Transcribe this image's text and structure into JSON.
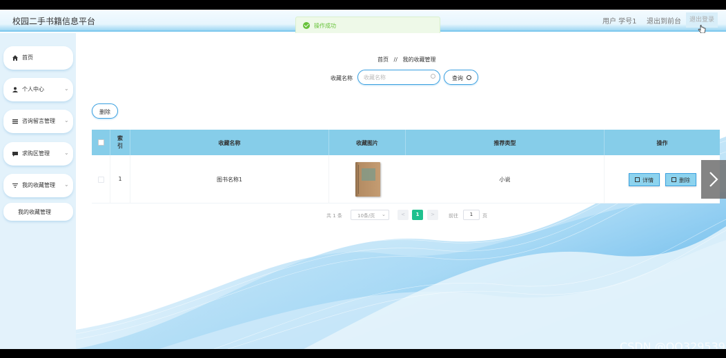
{
  "header": {
    "app_title": "校园二手书籍信息平台",
    "user_label": "用户 学号1",
    "front_label": "退出到前台",
    "logout_label": "退出登录"
  },
  "toast": {
    "message": "操作成功",
    "icon": "check-circle-icon",
    "color": "#67c23a"
  },
  "sidebar": {
    "items": [
      {
        "label": "首页",
        "icon": "home-icon"
      },
      {
        "label": "个人中心",
        "icon": "user-icon"
      },
      {
        "label": "咨询留言管理",
        "icon": "list-icon"
      },
      {
        "label": "求购区管理",
        "icon": "message-icon"
      },
      {
        "label": "我的收藏管理",
        "icon": "filter-icon"
      }
    ],
    "sub_item": "我的收藏管理"
  },
  "breadcrumb": {
    "home": "首页",
    "separator": "//",
    "current": "我的收藏管理"
  },
  "search": {
    "label": "收藏名称",
    "placeholder": "收藏名称",
    "button": "查询"
  },
  "actions": {
    "delete": "删除"
  },
  "table": {
    "headers": {
      "index": "索引",
      "name": "收藏名称",
      "image": "收藏图片",
      "type": "推荐类型",
      "ops": "操作"
    },
    "rows": [
      {
        "index": "1",
        "name": "图书名称1",
        "type": "小说",
        "detail": "详情",
        "delete": "删除"
      }
    ]
  },
  "pagination": {
    "total": "共 1 条",
    "page_size": "10条/页",
    "prev": "<",
    "current": "1",
    "next": ">",
    "goto": "前往",
    "goto_value": "1",
    "unit": "页"
  },
  "watermark": "CSDN @QQ3295391197",
  "colors": {
    "accent": "#3aa0e0",
    "header_row": "#86cde9",
    "pager_active": "#1fc08e"
  }
}
